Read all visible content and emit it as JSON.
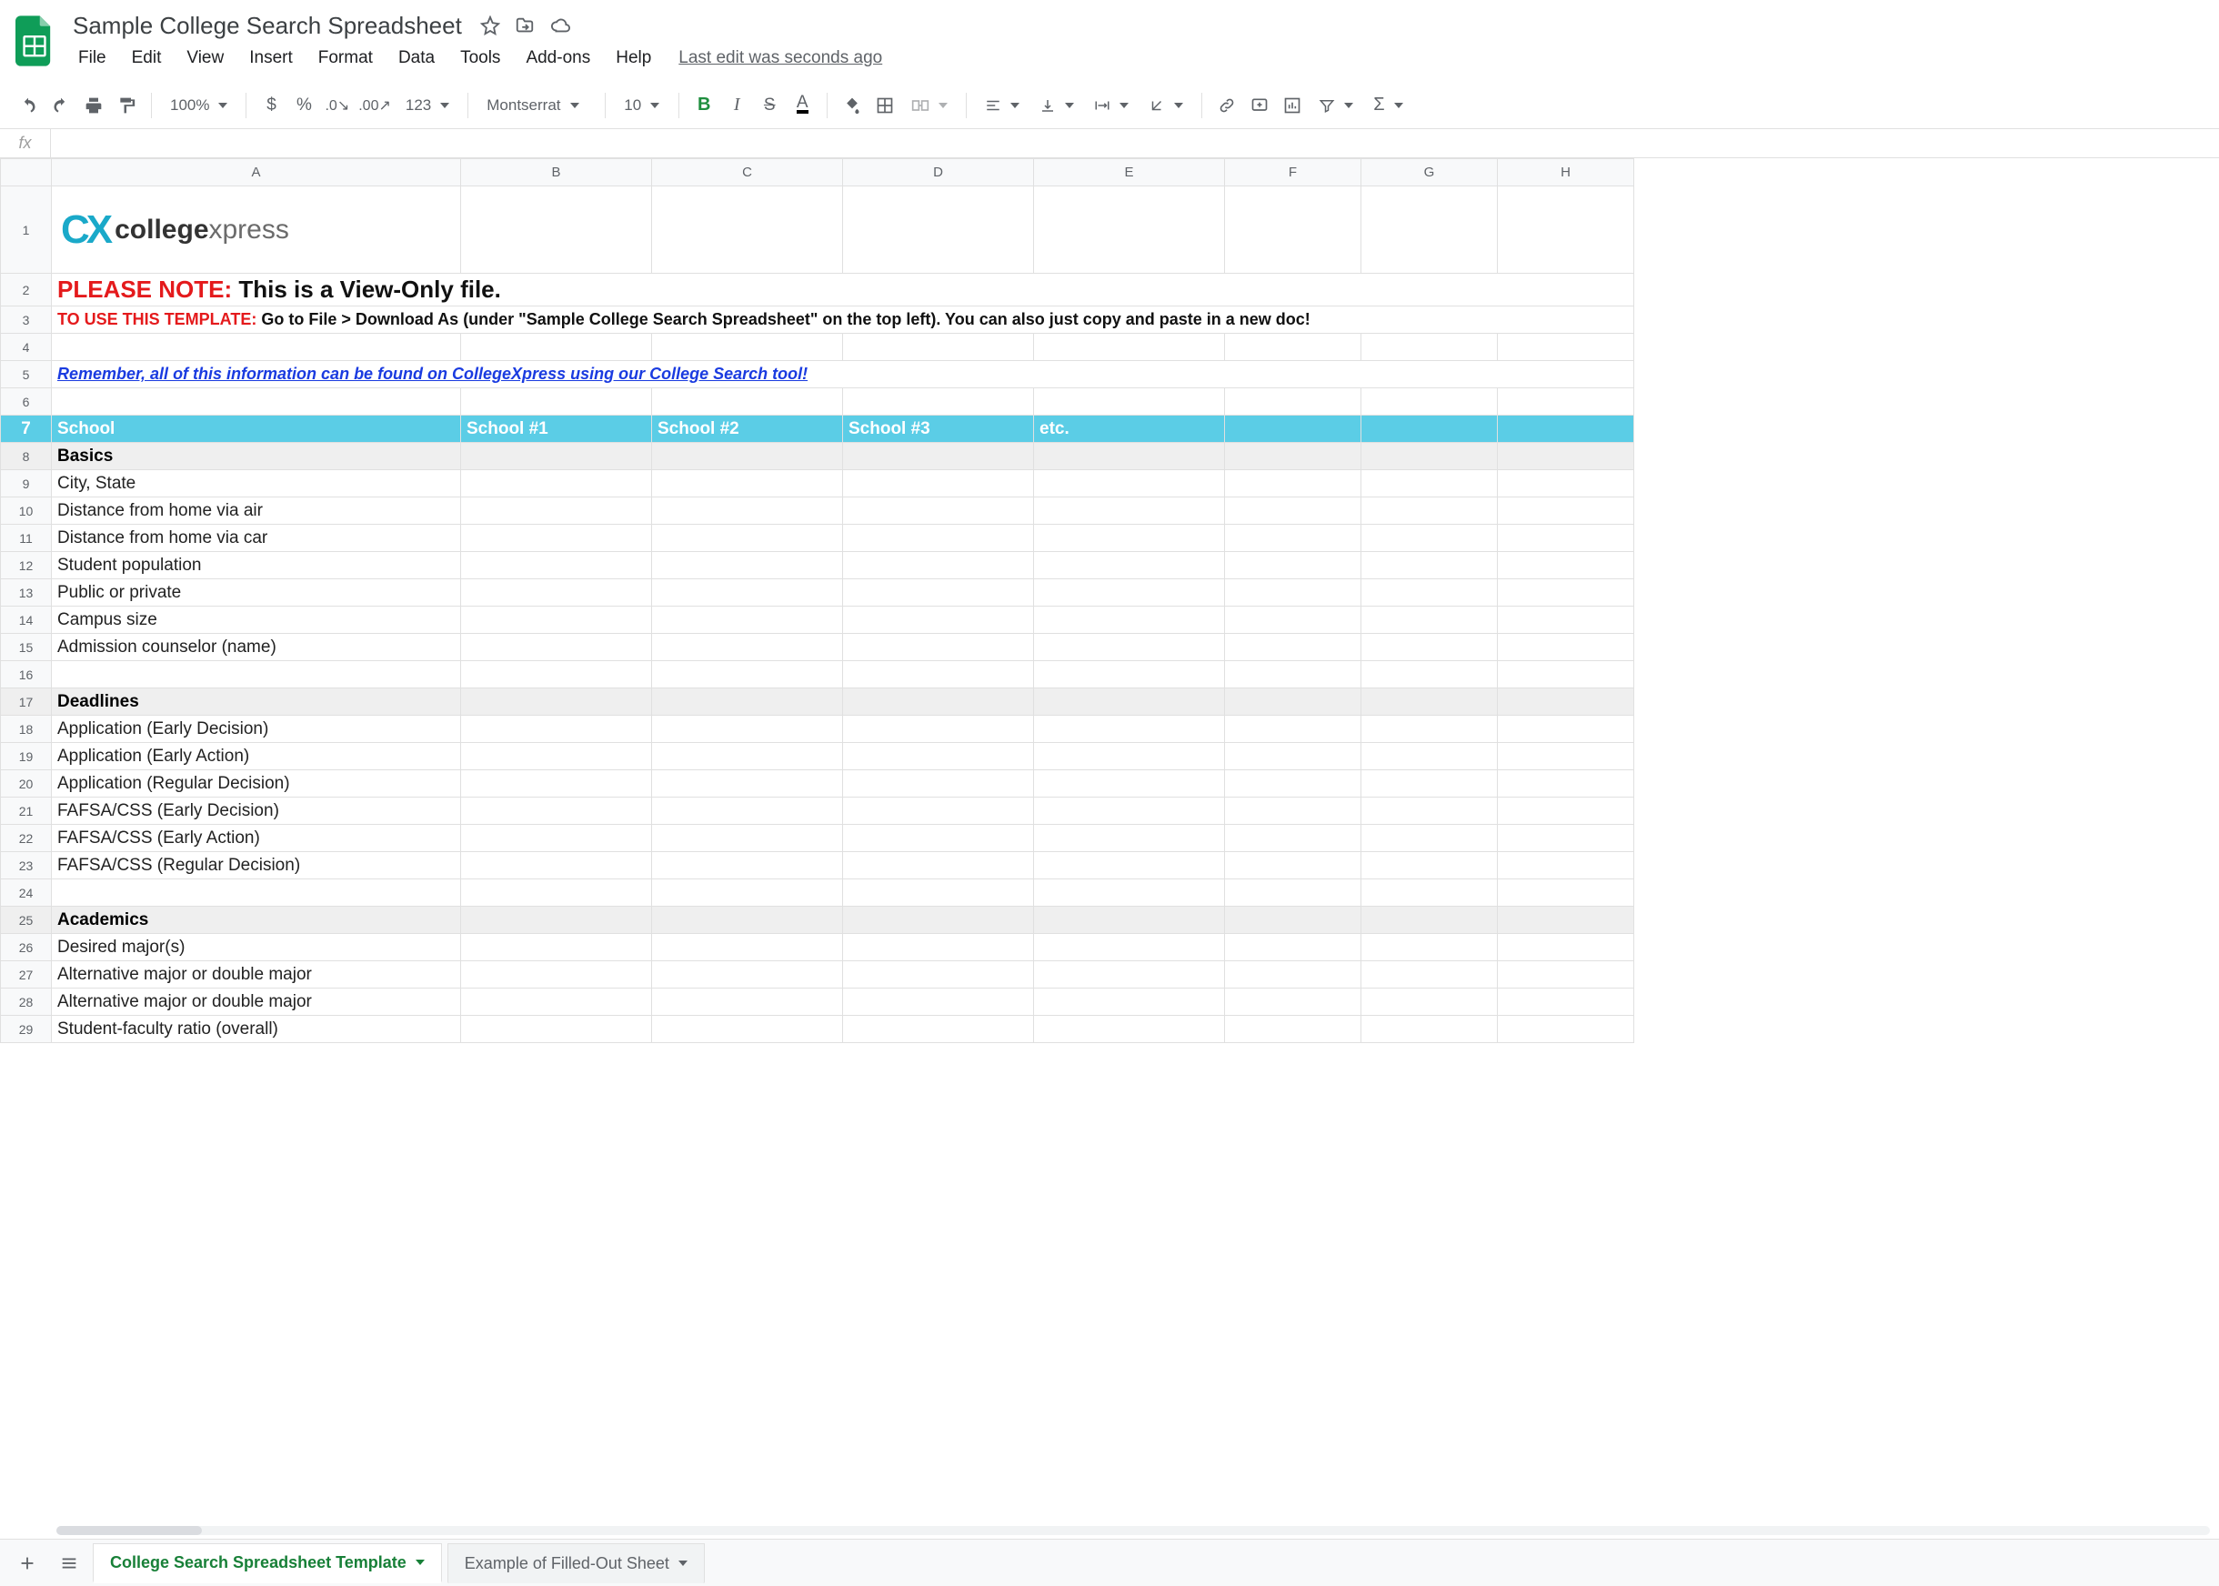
{
  "doc": {
    "title": "Sample College Search Spreadsheet",
    "last_edit": "Last edit was seconds ago"
  },
  "menus": [
    "File",
    "Edit",
    "View",
    "Insert",
    "Format",
    "Data",
    "Tools",
    "Add-ons",
    "Help"
  ],
  "toolbar": {
    "zoom": "100%",
    "font": "Montserrat",
    "size": "10",
    "more": "123"
  },
  "sheet_tabs": {
    "active": "College Search Spreadsheet Template",
    "inactive": "Example of Filled-Out Sheet"
  },
  "columns": [
    "A",
    "B",
    "C",
    "D",
    "E",
    "F",
    "G",
    "H"
  ],
  "content": {
    "logo_brand": "college",
    "logo_brand2": "xpress",
    "note_red": "PLEASE NOTE: ",
    "note_black": "This is a View-Only file.",
    "sub_red": "TO USE THIS TEMPLATE: ",
    "sub_black": "Go to File > Download As (under \"Sample College Search Spreadsheet\" on the top left). You can also just copy and paste in a new doc!",
    "link": "Remember, all of this information can be found on CollegeXpress using our College Search tool!",
    "header": [
      "School",
      "School #1",
      "School #2",
      "School #3",
      "etc.",
      "",
      "",
      ""
    ],
    "sections": [
      {
        "title": "Basics",
        "items": [
          "City, State",
          "Distance from home via air",
          "Distance from home via car",
          "Student population",
          "Public or private",
          "Campus size",
          "Admission counselor (name)"
        ]
      },
      {
        "title": "Deadlines",
        "items": [
          "Application (Early Decision)",
          "Application (Early Action)",
          "Application (Regular Decision)",
          "FAFSA/CSS (Early Decision)",
          "FAFSA/CSS (Early Action)",
          "FAFSA/CSS (Regular Decision)"
        ]
      },
      {
        "title": "Academics",
        "items": [
          "Desired major(s)",
          "Alternative major or double major",
          "Alternative major or double major",
          "Student-faculty ratio (overall)"
        ]
      }
    ]
  }
}
